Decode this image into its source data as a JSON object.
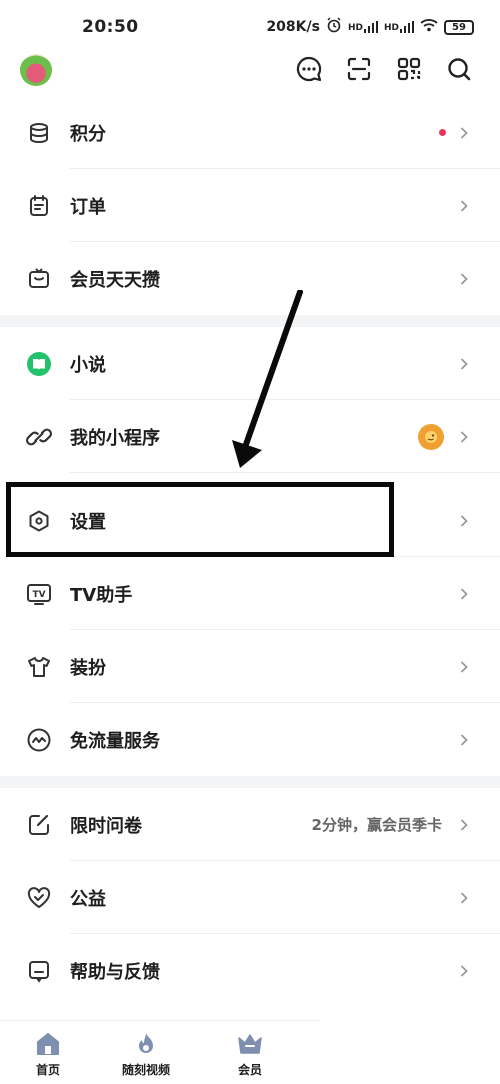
{
  "status": {
    "time": "20:50",
    "net_speed": "208K/s",
    "hd1": "HD",
    "hd2": "HD",
    "battery": "59"
  },
  "menu": {
    "points": "积分",
    "orders": "订单",
    "member_daily": "会员天天攒",
    "novel": "小说",
    "mini_programs": "我的小程序",
    "settings": "设置",
    "tv_assistant": "TV助手",
    "dress_up": "装扮",
    "data_free": "免流量服务",
    "survey": "限时问卷",
    "survey_extra": "2分钟，赢会员季卡",
    "charity": "公益",
    "help": "帮助与反馈"
  },
  "bottom_nav": {
    "home": "首页",
    "short_video": "随刻视频",
    "vip": "会员"
  },
  "colors": {
    "accent_red": "#e8365a",
    "novel_green": "#23c16b",
    "vip_blue": "#6f7f9f"
  }
}
